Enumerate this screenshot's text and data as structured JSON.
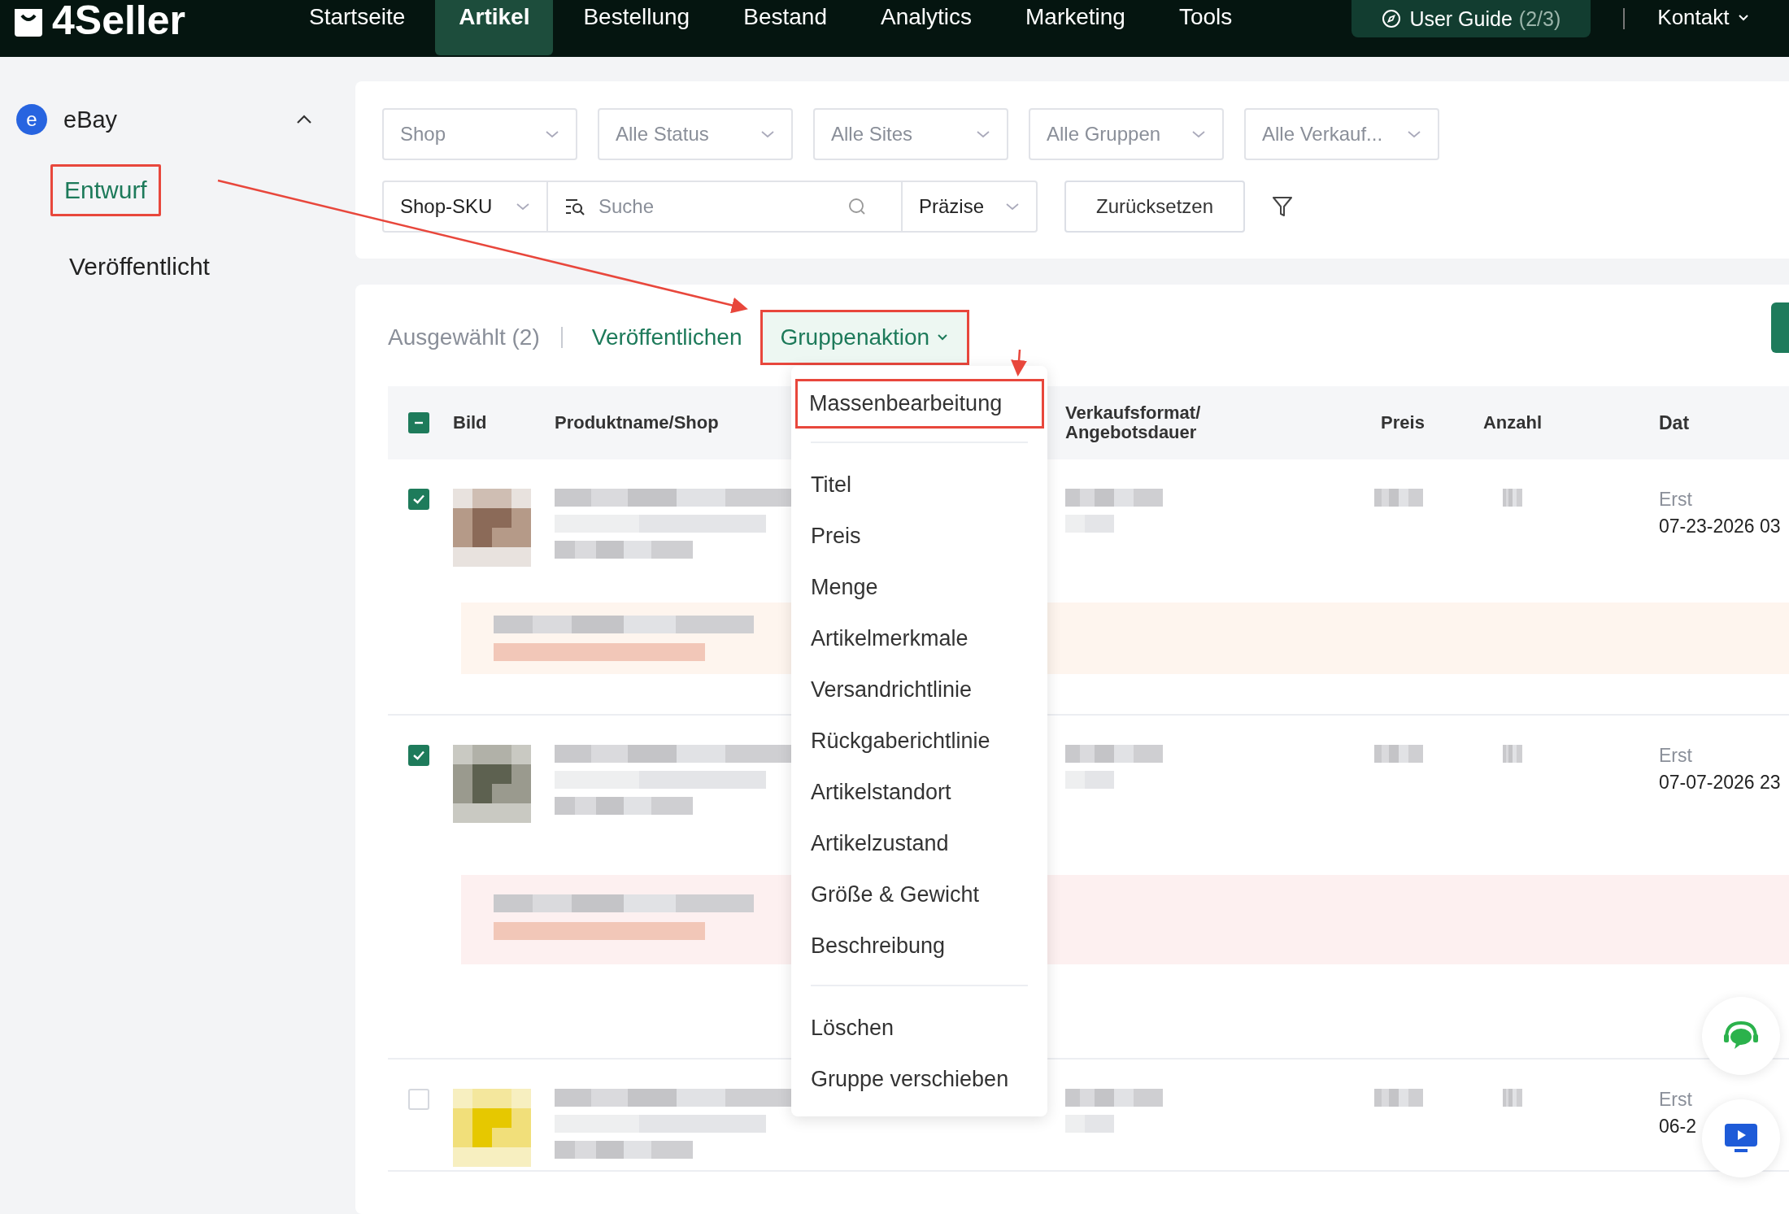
{
  "nav": {
    "logo": "4Seller",
    "items": [
      {
        "label": "Startseite",
        "selected": false
      },
      {
        "label": "Artikel",
        "selected": true
      },
      {
        "label": "Bestellung",
        "selected": false
      },
      {
        "label": "Bestand",
        "selected": false
      },
      {
        "label": "Analytics",
        "selected": false
      },
      {
        "label": "Marketing",
        "selected": false
      },
      {
        "label": "Tools",
        "selected": false
      }
    ],
    "guide": {
      "label": "User Guide",
      "progress": "(2/3)"
    },
    "contact": "Kontakt"
  },
  "sidebar": {
    "group": {
      "icon_letter": "e",
      "label": "eBay",
      "expanded": true
    },
    "items": [
      {
        "label": "Entwurf",
        "selected": true,
        "highlighted": true
      },
      {
        "label": "Veröffentlicht",
        "selected": false,
        "highlighted": false
      }
    ]
  },
  "filters": {
    "selects": [
      "Shop",
      "Alle Status",
      "Alle Sites",
      "Alle Gruppen",
      "Alle Verkauf..."
    ],
    "field_select": "Shop-SKU",
    "search": {
      "placeholder": "Suche"
    },
    "match": "Präzise",
    "reset": "Zurücksetzen"
  },
  "toolbar": {
    "selection": "Ausgewählt (2)",
    "publish": "Veröffentlichen",
    "group_action": {
      "label": "Gruppenaktion",
      "highlighted": true,
      "expanded": true
    }
  },
  "menu": {
    "sections": [
      [
        {
          "label": "Massenbearbeitung",
          "highlighted": true
        }
      ],
      [
        {
          "label": "Titel",
          "highlighted": false
        },
        {
          "label": "Preis",
          "highlighted": false
        },
        {
          "label": "Menge",
          "highlighted": false
        },
        {
          "label": "Artikelmerkmale",
          "highlighted": false
        },
        {
          "label": "Versandrichtlinie",
          "highlighted": false
        },
        {
          "label": "Rückgaberichtlinie",
          "highlighted": false
        },
        {
          "label": "Artikelstandort",
          "highlighted": false
        },
        {
          "label": "Artikelzustand",
          "highlighted": false
        },
        {
          "label": "Größe & Gewicht",
          "highlighted": false
        },
        {
          "label": "Beschreibung",
          "highlighted": false
        }
      ],
      [
        {
          "label": "Löschen",
          "highlighted": false
        },
        {
          "label": "Gruppe verschieben",
          "highlighted": false
        }
      ]
    ]
  },
  "table": {
    "select_all_indeterminate": true,
    "columns": [
      "Bild",
      "Produktname/Shop",
      "Verkaufsformat/ Angebotsdauer",
      "Preis",
      "Anzahl",
      "Dat"
    ],
    "rows": [
      {
        "checked": true,
        "notice": {
          "color": "#fef5ee"
        },
        "created": "Erst",
        "date": "07-23-2026 03"
      },
      {
        "checked": true,
        "notice": {
          "color": "#fdf0f0"
        },
        "created": "Erst",
        "date": "07-07-2026 23"
      },
      {
        "checked": false,
        "created": "Erst",
        "date": "06-2"
      }
    ]
  }
}
